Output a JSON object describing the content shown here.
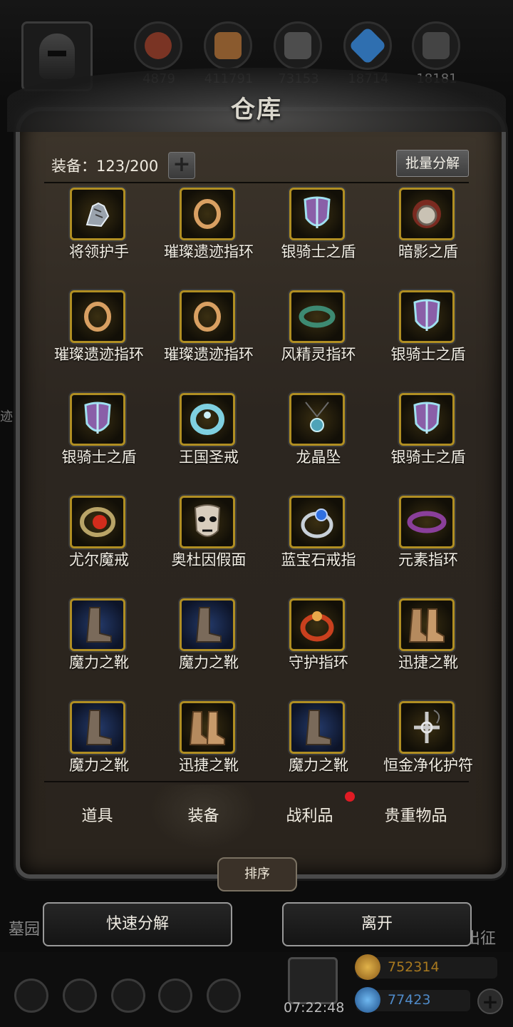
{
  "header": {
    "resources": [
      {
        "value": "4879",
        "icon": "meat-icon",
        "color": "#8a3a2a"
      },
      {
        "value": "411791",
        "icon": "wood-icon",
        "color": "#8a5a2e"
      },
      {
        "value": "73153",
        "icon": "stone-icon",
        "color": "#555555"
      },
      {
        "value": "18714",
        "icon": "crystal-icon",
        "color": "#2f6fb0"
      },
      {
        "value": "18181",
        "icon": "iron-icon",
        "color": "#4a4a4a"
      }
    ]
  },
  "side_left_label": "迹",
  "warehouse": {
    "title": "仓库",
    "count_label": "装备：123/200",
    "batch_button": "批量分解",
    "items": [
      {
        "name": "将领护手",
        "icon": "gauntlet-icon"
      },
      {
        "name": "璀璨遗迹指环",
        "icon": "gold-ring-icon"
      },
      {
        "name": "银骑士之盾",
        "icon": "shield-icon"
      },
      {
        "name": "暗影之盾",
        "icon": "dark-shield-icon"
      },
      {
        "name": "璀璨遗迹指环",
        "icon": "gold-ring-icon"
      },
      {
        "name": "璀璨遗迹指环",
        "icon": "gold-ring-icon"
      },
      {
        "name": "风精灵指环",
        "icon": "green-ring-icon"
      },
      {
        "name": "银骑士之盾",
        "icon": "shield-icon"
      },
      {
        "name": "银骑士之盾",
        "icon": "shield-icon"
      },
      {
        "name": "王国圣戒",
        "icon": "silver-ring-icon"
      },
      {
        "name": "龙晶坠",
        "icon": "pendant-icon"
      },
      {
        "name": "银骑士之盾",
        "icon": "shield-icon"
      },
      {
        "name": "尤尔魔戒",
        "icon": "ruby-ring-icon"
      },
      {
        "name": "奥杜因假面",
        "icon": "mask-icon"
      },
      {
        "name": "蓝宝石戒指",
        "icon": "sapphire-ring-icon"
      },
      {
        "name": "元素指环",
        "icon": "purple-ring-icon"
      },
      {
        "name": "魔力之靴",
        "icon": "magic-boots-icon"
      },
      {
        "name": "魔力之靴",
        "icon": "magic-boots-icon"
      },
      {
        "name": "守护指环",
        "icon": "red-ring-icon"
      },
      {
        "name": "迅捷之靴",
        "icon": "swift-boots-icon"
      },
      {
        "name": "魔力之靴",
        "icon": "magic-boots-icon"
      },
      {
        "name": "迅捷之靴",
        "icon": "swift-boots-icon"
      },
      {
        "name": "魔力之靴",
        "icon": "magic-boots-icon"
      },
      {
        "name": "恒金净化护符",
        "icon": "amulet-icon"
      }
    ],
    "tabs": [
      {
        "label": "道具"
      },
      {
        "label": "装备"
      },
      {
        "label": "战利品"
      },
      {
        "label": "贵重物品"
      }
    ],
    "active_tab": "装备",
    "sort_button": "排序"
  },
  "actions": {
    "quick_decompose": "快速分解",
    "leave": "离开"
  },
  "background_labels": {
    "left": "墓园",
    "right": "出征"
  },
  "bottom_bar": {
    "timer": "07:22:48",
    "gold": "752314",
    "gems": "77423"
  }
}
